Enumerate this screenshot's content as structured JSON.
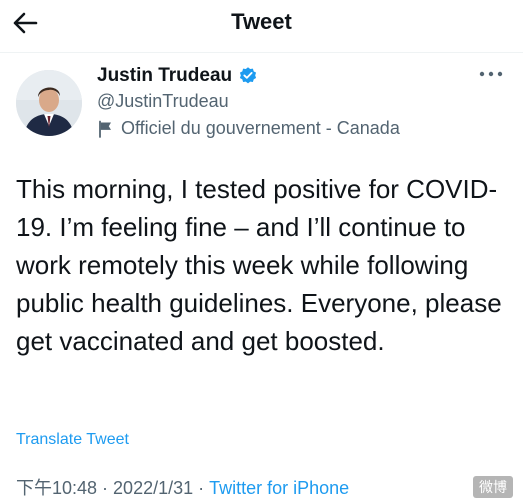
{
  "header": {
    "title": "Tweet",
    "back_icon": "arrow-left-icon"
  },
  "author": {
    "display_name": "Justin Trudeau",
    "handle": "@JustinTrudeau",
    "verified": true,
    "verified_color": "#1d9bf0",
    "label": "Officiel du gouvernement - Canada",
    "label_icon": "flag-icon"
  },
  "tweet": {
    "text": "This morning, I tested positive for COVID-19. I’m feeling fine – and I’ll continue to work remotely this week while following public health guidelines. Everyone, please get vaccinated and get boosted.",
    "translate_label": "Translate Tweet",
    "time": "下午10:48",
    "separator": " · ",
    "date": "2022/1/31",
    "source": "Twitter for iPhone"
  },
  "overlay": {
    "watermark": "微博"
  },
  "colors": {
    "text": "#0f1419",
    "secondary": "#536471",
    "link": "#1d9bf0",
    "divider": "#eff3f4"
  }
}
